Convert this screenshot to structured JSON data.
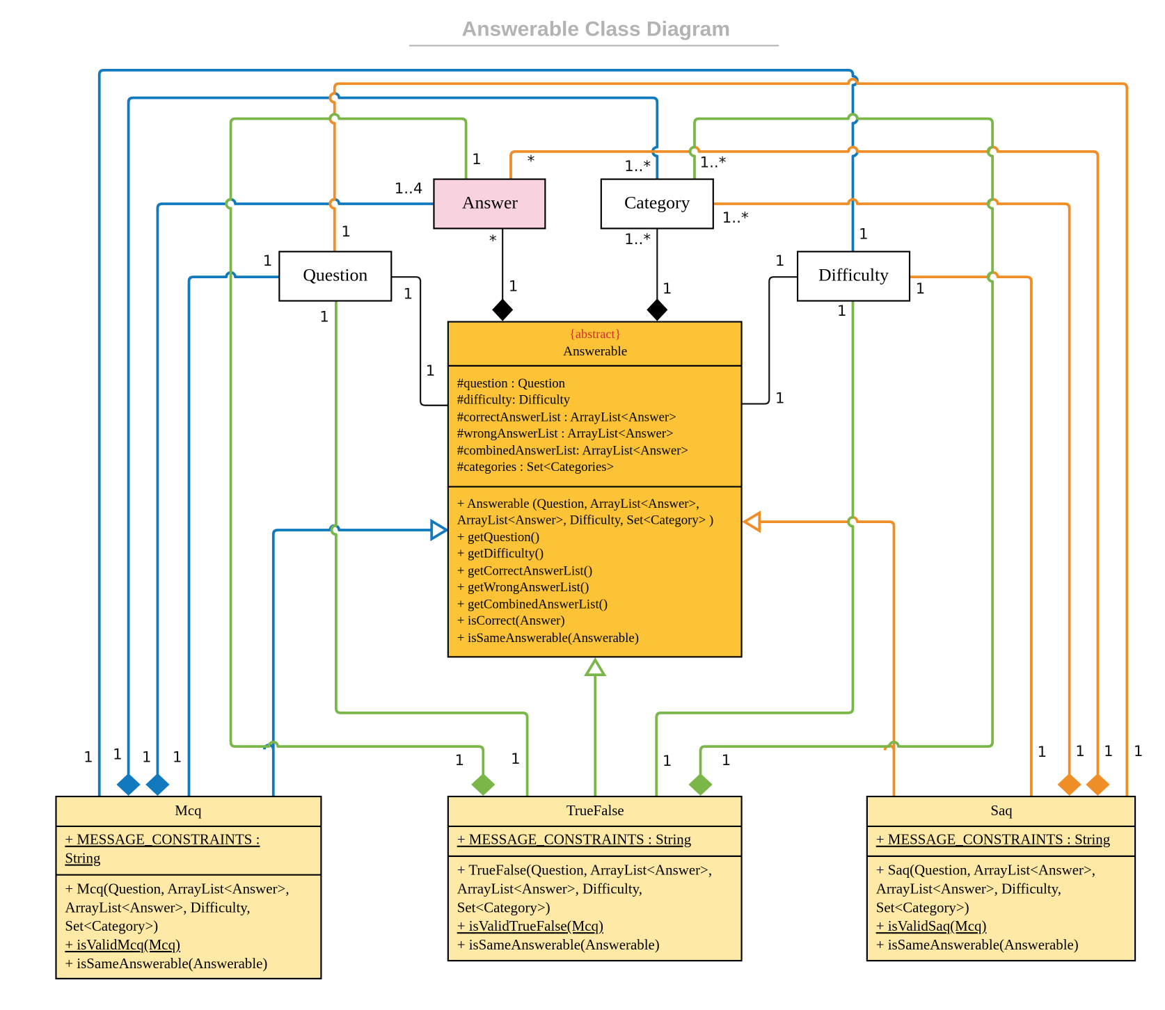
{
  "title": "Answerable Class Diagram",
  "colors": {
    "blue": "#1179bd",
    "orange": "#ef8d27",
    "green": "#7ab648",
    "answerable_fill": "#fbc335",
    "subclass_fill": "#fee9a6",
    "answer_fill": "#f8d3df",
    "abstract_label": "#d0312d"
  },
  "simple_classes": {
    "answer": "Answer",
    "category": "Category",
    "question": "Question",
    "difficulty": "Difficulty"
  },
  "answerable": {
    "stereotype": "{abstract}",
    "name": "Answerable",
    "attributes": [
      "#question : Question",
      "#difficulty: Difficulty",
      "#correctAnswerList : ArrayList<Answer>",
      "#wrongAnswerList : ArrayList<Answer>",
      "#combinedAnswerList: ArrayList<Answer>",
      "#categories : Set<Categories>"
    ],
    "methods": [
      "+ Answerable (Question, ArrayList<Answer>,",
      "ArrayList<Answer>, Difficulty, Set<Category> )",
      "+ getQuestion()",
      "+ getDifficulty()",
      "+ getCorrectAnswerList()",
      "+ getWrongAnswerList()",
      "+ getCombinedAnswerList()",
      "+ isCorrect(Answer)",
      "+ isSameAnswerable(Answerable)"
    ]
  },
  "mcq": {
    "name": "Mcq",
    "attributes": [
      "+ MESSAGE_CONSTRAINTS :",
      "String"
    ],
    "methods": [
      "+ Mcq(Question, ArrayList<Answer>,",
      "ArrayList<Answer>, Difficulty,",
      "Set<Category>)",
      "+ isValidMcq(Mcq)",
      "+ isSameAnswerable(Answerable)"
    ]
  },
  "truefalse": {
    "name": "TrueFalse",
    "attributes": [
      "+ MESSAGE_CONSTRAINTS : String"
    ],
    "methods": [
      "+ TrueFalse(Question, ArrayList<Answer>,",
      "ArrayList<Answer>, Difficulty,",
      "Set<Category>)",
      "+ isValidTrueFalse(Mcq)",
      "+ isSameAnswerable(Answerable)"
    ]
  },
  "saq": {
    "name": "Saq",
    "attributes": [
      "+ MESSAGE_CONSTRAINTS : String"
    ],
    "methods": [
      "+ Saq(Question, ArrayList<Answer>,",
      "ArrayList<Answer>, Difficulty,",
      "Set<Category>)",
      "+ isValidSaq(Mcq)",
      "+ isSameAnswerable(Answerable)"
    ]
  },
  "multiplicities": {
    "answer_top": "1",
    "answer_top_orange": "*",
    "answer_left": "1..4",
    "answer_bottom": "*",
    "answer_comp": "1",
    "category_top_blue": "1..*",
    "category_top_green": "1..*",
    "category_right": "1..*",
    "category_bottom": "1..*",
    "category_comp": "1",
    "question_top": "1",
    "question_left": "1",
    "question_right": "1",
    "question_bottom": "1",
    "answerable_left": "1",
    "difficulty_top": "1",
    "difficulty_left": "1",
    "difficulty_right": "1",
    "difficulty_bottom": "1",
    "answerable_right": "1",
    "mcq_1": "1",
    "mcq_2": "1",
    "mcq_3": "1",
    "mcq_4": "1",
    "tf_1": "1",
    "tf_2": "1",
    "tf_3": "1",
    "tf_4": "1",
    "saq_1": "1",
    "saq_2": "1",
    "saq_3": "1",
    "saq_4": "1"
  }
}
